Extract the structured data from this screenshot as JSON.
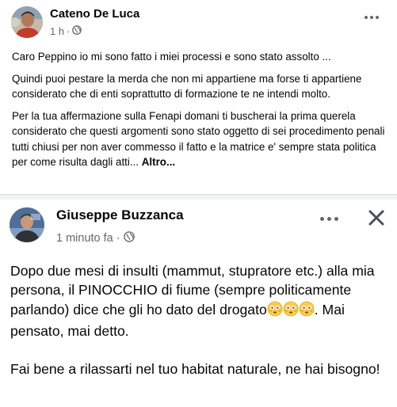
{
  "post1": {
    "author": "Cateno De Luca",
    "time": "1 h",
    "dot": "·",
    "paragraphs": [
      "Caro Peppino io mi sono fatto i miei processi e sono stato assolto ...",
      "Quindi puoi pestare la merda che non mi appartiene ma forse ti appartiene considerato che di enti soprattutto di formazione te ne intendi molto.",
      "Per la tua affermazione sulla Fenapi domani ti buscherai la prima querela considerato che questi argomenti sono stato oggetto di sei procedimento penali tutti chiusi per non aver commesso il fatto e la matrice e' sempre stata politica per come risulta dagli atti..."
    ],
    "see_more": "Altro...",
    "icons": {
      "privacy": "globe-icon",
      "menu": "more-options-icon"
    }
  },
  "post2": {
    "author": "Giuseppe Buzzanca",
    "time": "1 minuto fa",
    "dot": "·",
    "paragraph1_main": "Dopo due mesi di insulti (mammut, stupratore etc.) alla mia persona, il PINOCCHIO di fiume (sempre politicamente parlando) dice che gli ho dato del drogato",
    "paragraph1_tail": ". Mai pensato, mai detto.",
    "paragraph2": "Fai bene a rilassarti nel tuo habitat naturale, ne hai bisogno!",
    "emoji": "flushed-face",
    "emoji_count": 3,
    "icons": {
      "privacy": "globe-icon",
      "menu": "more-options-icon",
      "close": "close-icon"
    }
  }
}
